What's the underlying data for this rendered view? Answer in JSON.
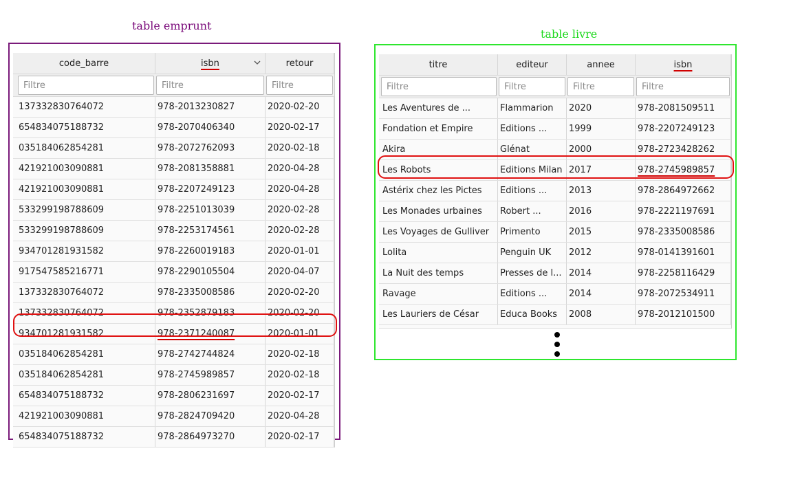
{
  "emprunt": {
    "caption": "table  emprunt",
    "columns": [
      {
        "label": "code_barre"
      },
      {
        "label": "isbn"
      },
      {
        "label": "retour"
      }
    ],
    "filter_placeholder": "Filtre",
    "rows": [
      [
        "137332830764072",
        "978-2013230827",
        "2020-02-20"
      ],
      [
        "654834075188732",
        "978-2070406340",
        "2020-02-17"
      ],
      [
        "035184062854281",
        "978-2072762093",
        "2020-02-18"
      ],
      [
        "421921003090881",
        "978-2081358881",
        "2020-04-28"
      ],
      [
        "421921003090881",
        "978-2207249123",
        "2020-04-28"
      ],
      [
        "533299198788609",
        "978-2251013039",
        "2020-02-28"
      ],
      [
        "533299198788609",
        "978-2253174561",
        "2020-02-28"
      ],
      [
        "934701281931582",
        "978-2260019183",
        "2020-01-01"
      ],
      [
        "917547585216771",
        "978-2290105504",
        "2020-04-07"
      ],
      [
        "137332830764072",
        "978-2335008586",
        "2020-02-20"
      ],
      [
        "137332830764072",
        "978-2352879183",
        "2020-02-20"
      ],
      [
        "934701281931582",
        "978-2371240087",
        "2020-01-01"
      ],
      [
        "035184062854281",
        "978-2742744824",
        "2020-02-18"
      ],
      [
        "035184062854281",
        "978-2745989857",
        "2020-02-18"
      ],
      [
        "654834075188732",
        "978-2806231697",
        "2020-02-17"
      ],
      [
        "421921003090881",
        "978-2824709420",
        "2020-04-28"
      ],
      [
        "654834075188732",
        "978-2864973270",
        "2020-02-17"
      ]
    ],
    "highlight_row": 11
  },
  "livre": {
    "caption": "table  livre",
    "columns": [
      {
        "label": "titre"
      },
      {
        "label": "editeur"
      },
      {
        "label": "annee"
      },
      {
        "label": "isbn"
      }
    ],
    "filter_placeholder": "Filtre",
    "rows": [
      [
        "Les Aventures de ...",
        "Flammarion",
        "2020",
        "978-2081509511"
      ],
      [
        "Fondation et Empire",
        "Editions ...",
        "1999",
        "978-2207249123"
      ],
      [
        "Akira",
        "Glénat",
        "2000",
        "978-2723428262"
      ],
      [
        "Les Robots",
        "Editions Milan",
        "2017",
        "978-2745989857"
      ],
      [
        "Astérix chez les Pictes",
        "Editions ...",
        "2013",
        "978-2864972662"
      ],
      [
        "Les Monades urbaines",
        "Robert ...",
        "2016",
        "978-2221197691"
      ],
      [
        "Les Voyages de Gulliver",
        "Primento",
        "2015",
        "978-2335008586"
      ],
      [
        "Lolita",
        "Penguin UK",
        "2012",
        "978-0141391601"
      ],
      [
        "La Nuit des temps",
        "Presses de l...",
        "2014",
        "978-2258116429"
      ],
      [
        "Ravage",
        "Editions ...",
        "2014",
        "978-2072534911"
      ],
      [
        "Les Lauriers de César",
        "Educa Books",
        "2008",
        "978-2012101500"
      ]
    ],
    "highlight_row": 3
  },
  "colors": {
    "emprunt_frame": "#7a1a7a",
    "livre_frame": "#2ee62e",
    "highlight": "#e01010"
  }
}
